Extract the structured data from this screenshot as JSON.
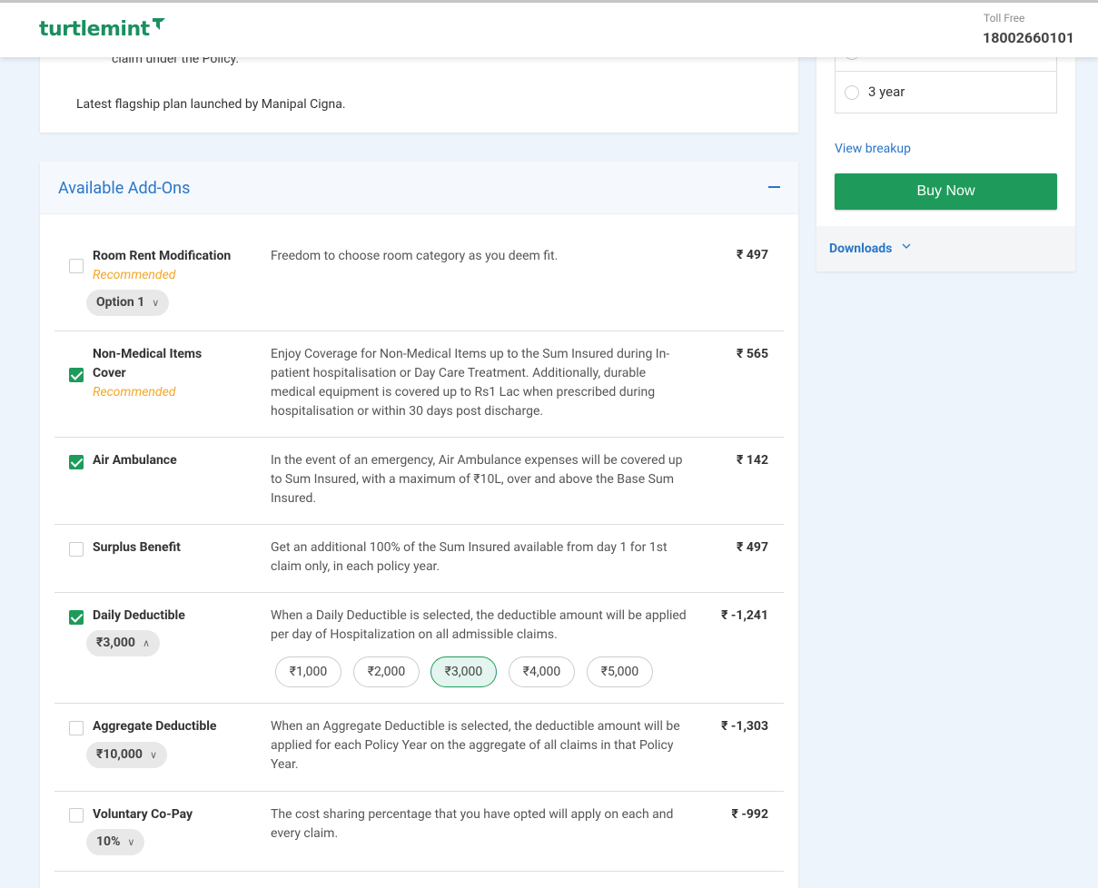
{
  "header": {
    "logo": "turtlemint",
    "toll_free_label": "Toll Free",
    "toll_free_number": "18002660101"
  },
  "info_card": {
    "cut_text": "claim under the Policy.",
    "line": "Latest flagship plan launched by Manipal Cigna."
  },
  "sidebar": {
    "tenure_option": "3 year",
    "view_breakup": "View breakup",
    "buy_now": "Buy Now",
    "downloads": "Downloads"
  },
  "addons": {
    "title": "Available Add-Ons",
    "items": [
      {
        "name": "Room Rent Modification",
        "recommended": "Recommended",
        "checked": false,
        "selector": "Option 1",
        "description": "Freedom to choose room category as you deem fit.",
        "price": "₹ 497"
      },
      {
        "name": "Non-Medical Items Cover",
        "recommended": "Recommended",
        "checked": true,
        "description": "Enjoy Coverage for Non-Medical Items up to the Sum Insured during In-patient hospitalisation or Day Care Treatment. Additionally, durable medical equipment is covered up to Rs1 Lac when prescribed during hospitalisation or within 30 days post discharge.",
        "price": "₹ 565"
      },
      {
        "name": "Air Ambulance",
        "checked": true,
        "description": "In the event of an emergency, Air Ambulance expenses will be covered up to Sum Insured, with a maximum of ₹10L, over and above the Base Sum Insured.",
        "price": "₹ 142"
      },
      {
        "name": "Surplus Benefit",
        "checked": false,
        "description": "Get an additional 100% of the Sum Insured available from day 1 for 1st claim only, in each policy year.",
        "price": "₹ 497"
      },
      {
        "name": "Daily Deductible",
        "checked": true,
        "selector": "₹3,000",
        "description": "When a Daily Deductible is selected, the deductible amount will be applied per day of Hospitalization on all admissible claims.",
        "price": "₹ -1,241",
        "options": [
          "₹1,000",
          "₹2,000",
          "₹3,000",
          "₹4,000",
          "₹5,000"
        ],
        "selected_option": "₹3,000"
      },
      {
        "name": "Aggregate Deductible",
        "checked": false,
        "selector": "₹10,000",
        "description": "When an Aggregate Deductible is selected, the deductible amount will be applied for each Policy Year on the aggregate of all claims in that Policy Year.",
        "price": "₹ -1,303"
      },
      {
        "name": "Voluntary Co-Pay",
        "checked": false,
        "selector": "10%",
        "description": "The cost sharing percentage that you have opted will apply on each and every claim.",
        "price": "₹ -992"
      }
    ]
  },
  "colors": {
    "brand_green": "#1e9b5b",
    "link_blue": "#2a76c6",
    "recommended_orange": "#f5a623"
  }
}
